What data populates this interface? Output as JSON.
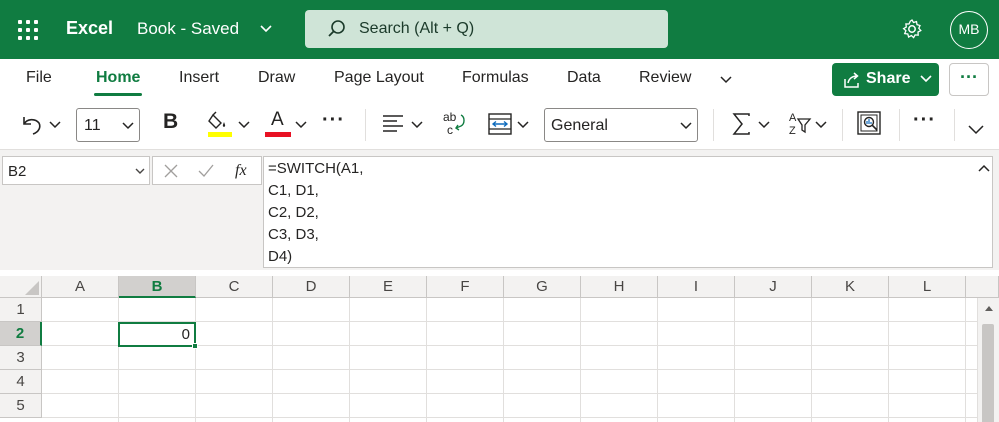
{
  "app": {
    "name": "Excel",
    "doc_title": "Book - Saved",
    "avatar_initials": "MB",
    "brand_color": "#107c41"
  },
  "search": {
    "placeholder": "Search (Alt + Q)"
  },
  "tabs": [
    "File",
    "Home",
    "Insert",
    "Draw",
    "Page Layout",
    "Formulas",
    "Data",
    "Review"
  ],
  "active_tab": "Home",
  "share": {
    "label": "Share",
    "more": "···"
  },
  "ribbon": {
    "font_size": "11",
    "bold": "B",
    "number_format": "General",
    "more": "···",
    "wrap_icon": "ab↵",
    "font_color_letter": "A"
  },
  "formula_bar": {
    "name_box": "B2",
    "fx_label": "fx",
    "formula_lines": [
      "=SWITCH(A1,",
      "C1, D1,",
      "C2, D2,",
      "C3, D3,",
      "D4)"
    ]
  },
  "grid": {
    "columns": [
      "A",
      "B",
      "C",
      "D",
      "E",
      "F",
      "G",
      "H",
      "I",
      "J",
      "K",
      "L"
    ],
    "rows": [
      "1",
      "2",
      "3",
      "4",
      "5"
    ],
    "selected_column": "B",
    "selected_row": "2",
    "active_cell_value": "0"
  }
}
